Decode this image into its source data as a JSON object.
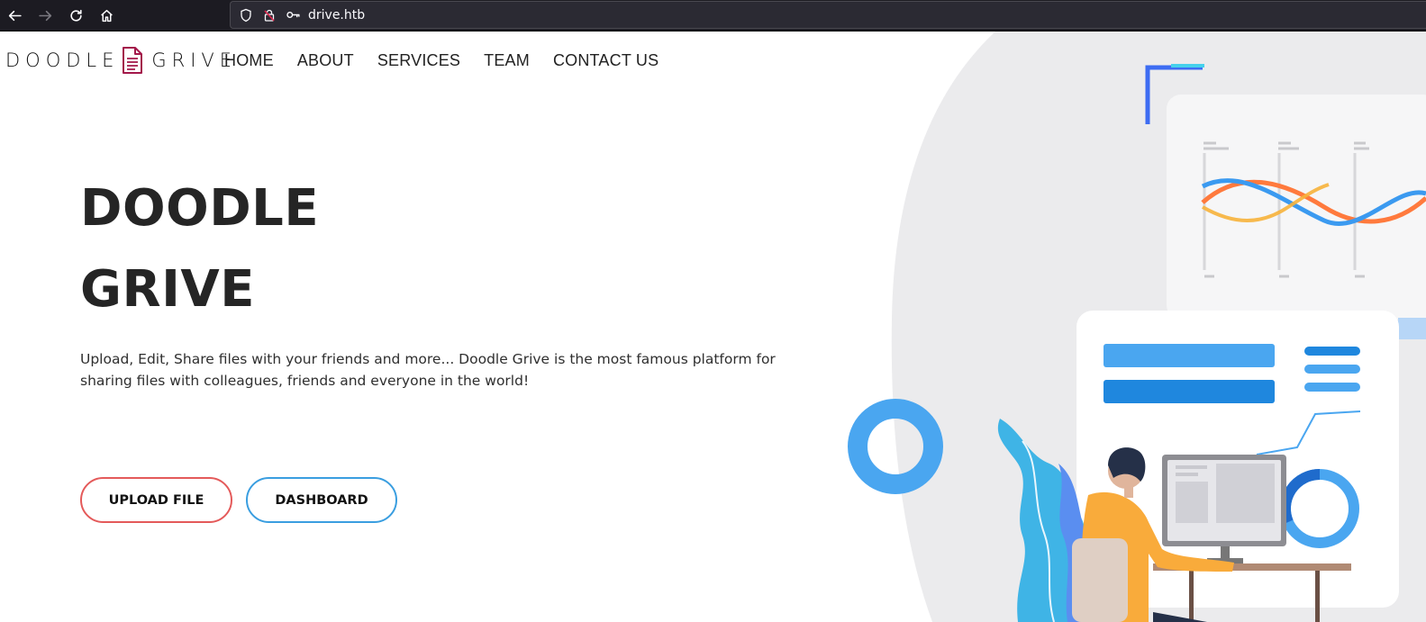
{
  "browser": {
    "url": "drive.htb",
    "icons": [
      "back-arrow-icon",
      "forward-arrow-icon",
      "reload-icon",
      "home-icon",
      "shield-icon",
      "lock-icon",
      "key-icon"
    ]
  },
  "logo": {
    "left": "DOODLE",
    "right": "GRIVE",
    "icon": "document-icon"
  },
  "menu": {
    "items": [
      {
        "label": "HOME"
      },
      {
        "label": "ABOUT"
      },
      {
        "label": "SERVICES"
      },
      {
        "label": "TEAM"
      },
      {
        "label": "CONTACT US"
      }
    ]
  },
  "hero": {
    "title_line1": "DOODLE",
    "title_line2": "GRIVE",
    "description": "Upload, Edit, Share files with your friends and more... Doodle Grive is the most famous platform for sharing files with colleagues, friends and everyone in the world!",
    "upload_label": "UPLOAD FILE",
    "dashboard_label": "DASHBOARD"
  },
  "colors": {
    "upload_border": "#e45a5a",
    "dashboard_border": "#3a9ee0",
    "logo_icon": "#a3174a",
    "illustration_blue": "#4aa6f0"
  }
}
